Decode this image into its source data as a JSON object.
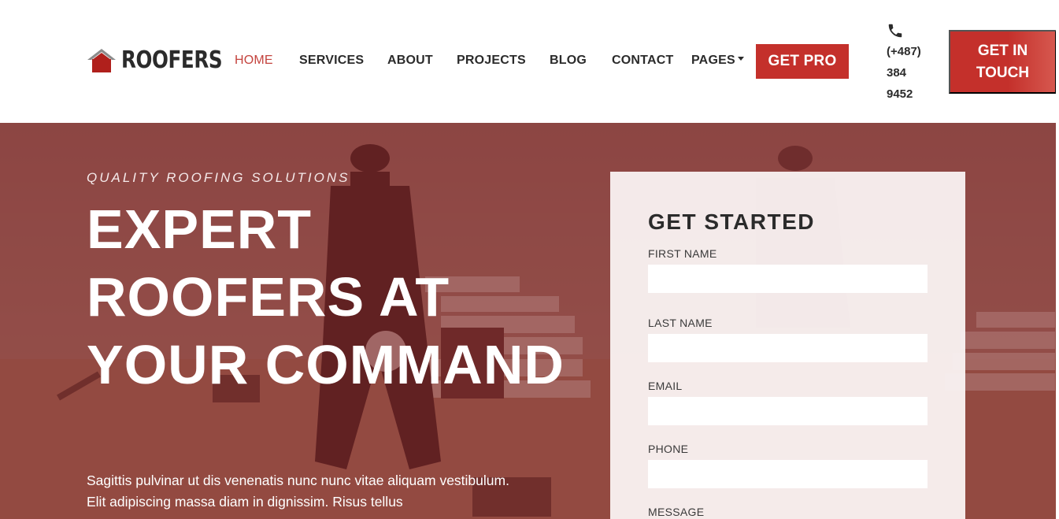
{
  "brand": {
    "name": "ROOFERS",
    "logo_icon": "house-roof-icon",
    "accent_color": "#c4302b"
  },
  "nav": {
    "items": [
      {
        "label": "HOME",
        "active": true
      },
      {
        "label": "SERVICES"
      },
      {
        "label": "ABOUT"
      },
      {
        "label": "PROJECTS"
      },
      {
        "label": "BLOG"
      },
      {
        "label": "CONTACT"
      },
      {
        "label": "PAGES",
        "dropdown": true
      }
    ],
    "cta_pro": "GET PRO"
  },
  "contact": {
    "phone_icon": "phone-icon",
    "phone": "(+487)\n384\n9452",
    "cta_touch": "GET IN TOUCH"
  },
  "hero": {
    "tagline": "QUALITY ROOFING SOLUTIONS",
    "headline": "EXPERT ROOFERS AT YOUR COMMAND",
    "description": "Sagittis pulvinar ut dis venenatis nunc nunc vitae aliquam vestibulum. Elit adipiscing massa diam in dignissim. Risus tellus"
  },
  "form": {
    "title": "GET STARTED",
    "fields": [
      {
        "label": "FIRST NAME",
        "value": ""
      },
      {
        "label": "LAST NAME",
        "value": ""
      },
      {
        "label": "EMAIL",
        "value": ""
      },
      {
        "label": "PHONE",
        "value": ""
      },
      {
        "label": "MESSAGE",
        "value": ""
      }
    ]
  }
}
